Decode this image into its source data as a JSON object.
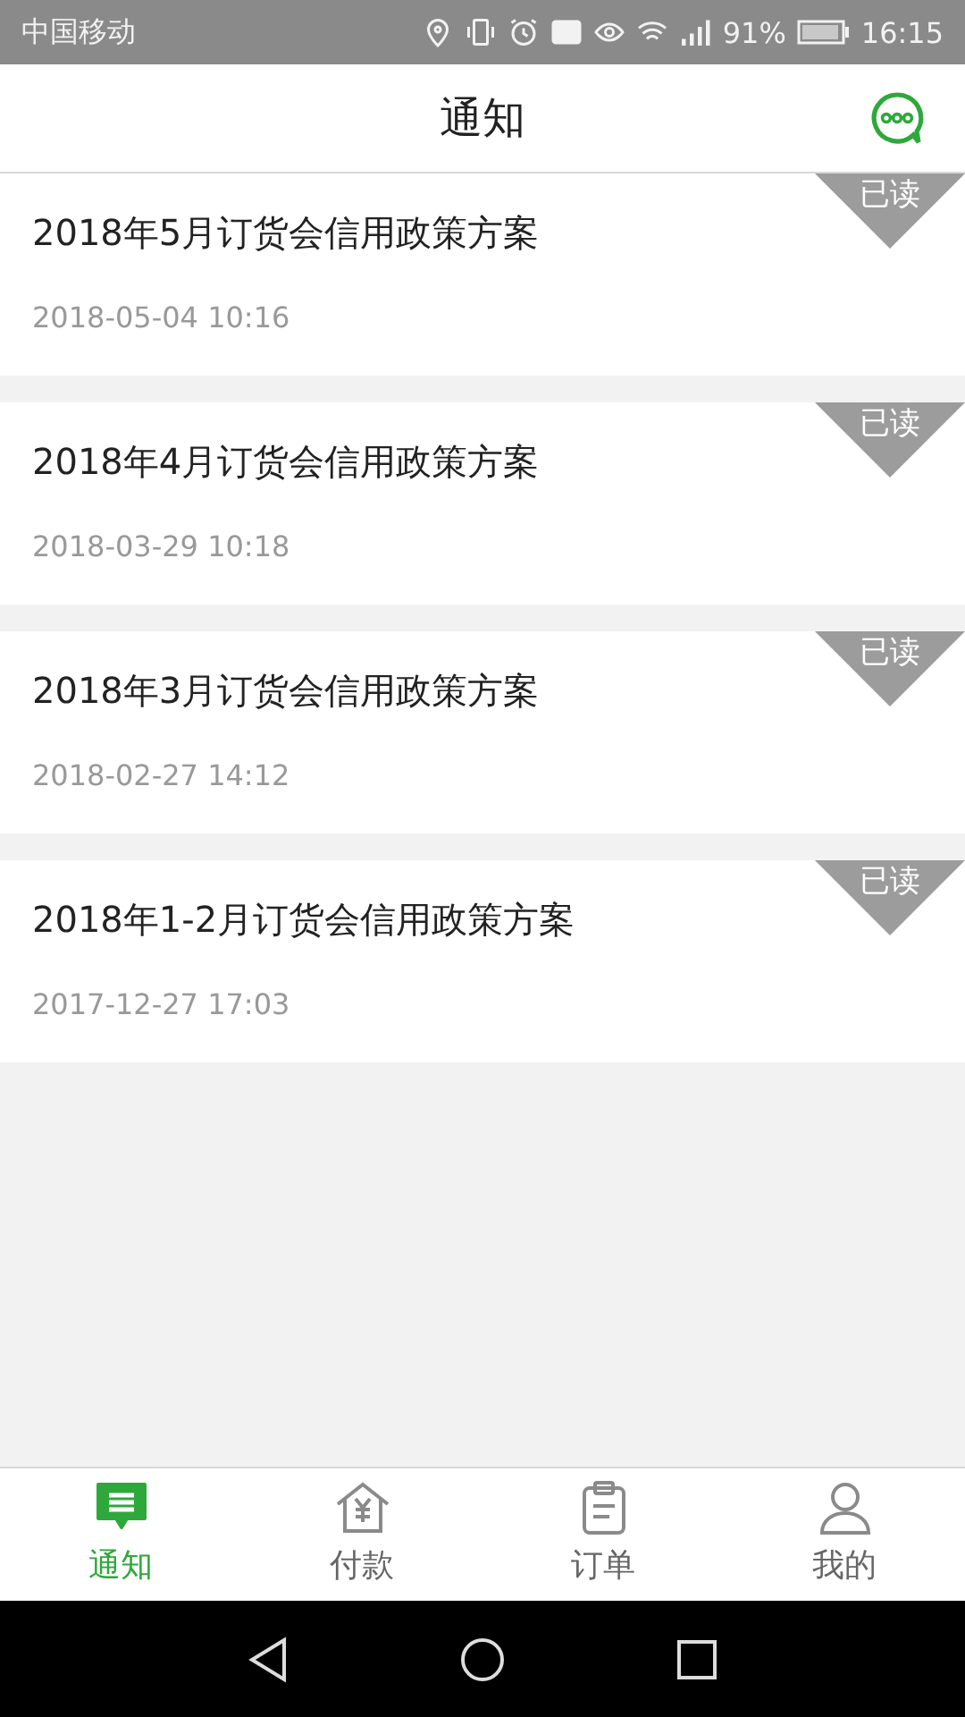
{
  "status_bar": {
    "carrier": "中国移动",
    "battery": "91%",
    "time": "16:15"
  },
  "header": {
    "title": "通知"
  },
  "notices": [
    {
      "title": "2018年5月订货会信用政策方案",
      "date": "2018-05-04 10:16",
      "read": true,
      "badge": "已读"
    },
    {
      "title": "2018年4月订货会信用政策方案",
      "date": "2018-03-29 10:18",
      "read": true,
      "badge": "已读"
    },
    {
      "title": "2018年3月订货会信用政策方案",
      "date": "2018-02-27 14:12",
      "read": true,
      "badge": "已读"
    },
    {
      "title": "2018年1-2月订货会信用政策方案",
      "date": "2017-12-27 17:03",
      "read": true,
      "badge": "已读"
    }
  ],
  "tabs": [
    {
      "label": "通知",
      "kind": "notice",
      "selected": true
    },
    {
      "label": "付款",
      "kind": "payment",
      "selected": false
    },
    {
      "label": "订单",
      "kind": "order",
      "selected": false
    },
    {
      "label": "我的",
      "kind": "profile",
      "selected": false
    }
  ]
}
